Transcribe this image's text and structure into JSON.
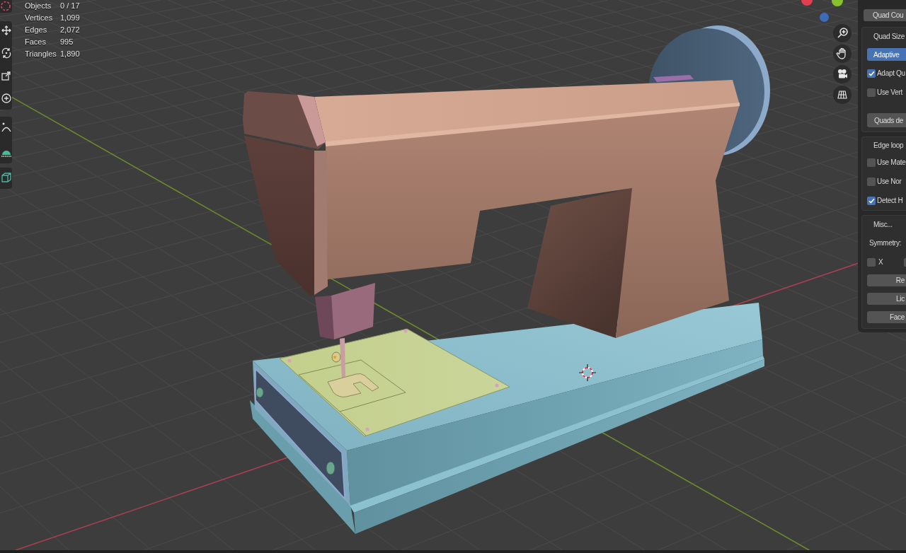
{
  "stats": [
    {
      "label": "Objects",
      "value": "0 / 17"
    },
    {
      "label": "Vertices",
      "value": "1,099"
    },
    {
      "label": "Edges",
      "value": "2,072"
    },
    {
      "label": "Faces",
      "value": "995"
    },
    {
      "label": "Triangles",
      "value": "1,890"
    }
  ],
  "panel": {
    "top_button": "Quad Cou",
    "sections": [
      {
        "title": "Quad Size",
        "items": [
          {
            "kind": "toggle",
            "label": "Adaptive",
            "on": true
          },
          {
            "kind": "checkbox",
            "label": "Adapt Qu",
            "checked": true
          },
          {
            "kind": "checkbox",
            "label": "Use Vert",
            "checked": false
          },
          {
            "kind": "button",
            "label": "Quads de"
          }
        ]
      },
      {
        "title": "Edge loop",
        "items": [
          {
            "kind": "checkbox",
            "label": "Use Mate",
            "checked": false
          },
          {
            "kind": "checkbox",
            "label": "Use Nor",
            "checked": false
          },
          {
            "kind": "checkbox",
            "label": "Detect H",
            "checked": true
          }
        ]
      },
      {
        "title": "Misc...",
        "items": [
          {
            "kind": "label",
            "label": "Symmetry:"
          },
          {
            "kind": "checkbox_row",
            "boxes": [
              {
                "label": "X",
                "checked": false
              },
              {
                "checked": false
              }
            ]
          },
          {
            "kind": "button",
            "label": "Re"
          },
          {
            "kind": "button",
            "label": "Lic"
          },
          {
            "kind": "button",
            "label": "Face"
          }
        ]
      }
    ]
  }
}
